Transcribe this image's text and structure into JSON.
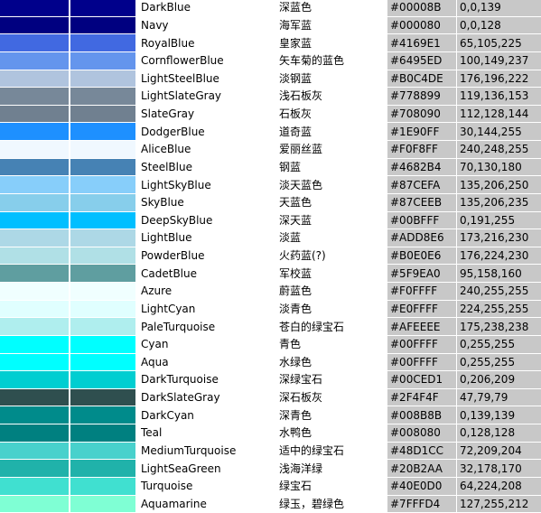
{
  "rows": [
    {
      "name": "DarkBlue",
      "zh": "深蓝色",
      "hex": "#00008B",
      "rgb": "0,0,139",
      "color": "#00008B"
    },
    {
      "name": "Navy",
      "zh": "海军蓝",
      "hex": "#000080",
      "rgb": "0,0,128",
      "color": "#000080"
    },
    {
      "name": "RoyalBlue",
      "zh": "皇家蓝",
      "hex": "#4169E1",
      "rgb": "65,105,225",
      "color": "#4169E1"
    },
    {
      "name": "CornflowerBlue",
      "zh": "矢车菊的蓝色",
      "hex": "#6495ED",
      "rgb": "100,149,237",
      "color": "#6495ED"
    },
    {
      "name": "LightSteelBlue",
      "zh": "淡钢蓝",
      "hex": "#B0C4DE",
      "rgb": "176,196,222",
      "color": "#B0C4DE"
    },
    {
      "name": "LightSlateGray",
      "zh": "浅石板灰",
      "hex": "#778899",
      "rgb": "119,136,153",
      "color": "#778899"
    },
    {
      "name": "SlateGray",
      "zh": "石板灰",
      "hex": "#708090",
      "rgb": "112,128,144",
      "color": "#708090"
    },
    {
      "name": "DodgerBlue",
      "zh": "道奇蓝",
      "hex": "#1E90FF",
      "rgb": "30,144,255",
      "color": "#1E90FF"
    },
    {
      "name": "AliceBlue",
      "zh": "爱丽丝蓝",
      "hex": "#F0F8FF",
      "rgb": "240,248,255",
      "color": "#F0F8FF"
    },
    {
      "name": "SteelBlue",
      "zh": "钢蓝",
      "hex": "#4682B4",
      "rgb": "70,130,180",
      "color": "#4682B4"
    },
    {
      "name": "LightSkyBlue",
      "zh": "淡天蓝色",
      "hex": "#87CEFA",
      "rgb": "135,206,250",
      "color": "#87CEFA"
    },
    {
      "name": "SkyBlue",
      "zh": "天蓝色",
      "hex": "#87CEEB",
      "rgb": "135,206,235",
      "color": "#87CEEB"
    },
    {
      "name": "DeepSkyBlue",
      "zh": "深天蓝",
      "hex": "#00BFFF",
      "rgb": "0,191,255",
      "color": "#00BFFF"
    },
    {
      "name": "LightBlue",
      "zh": "淡蓝",
      "hex": "#ADD8E6",
      "rgb": "173,216,230",
      "color": "#ADD8E6"
    },
    {
      "name": "PowderBlue",
      "zh": "火药蓝(?)",
      "hex": "#B0E0E6",
      "rgb": "176,224,230",
      "color": "#B0E0E6"
    },
    {
      "name": "CadetBlue",
      "zh": "军校蓝",
      "hex": "#5F9EA0",
      "rgb": "95,158,160",
      "color": "#5F9EA0"
    },
    {
      "name": "Azure",
      "zh": "蔚蓝色",
      "hex": "#F0FFFF",
      "rgb": "240,255,255",
      "color": "#F0FFFF"
    },
    {
      "name": "LightCyan",
      "zh": "淡青色",
      "hex": "#E0FFFF",
      "rgb": "224,255,255",
      "color": "#E0FFFF"
    },
    {
      "name": "PaleTurquoise",
      "zh": "苍白的绿宝石",
      "hex": "#AFEEEE",
      "rgb": "175,238,238",
      "color": "#AFEEEE"
    },
    {
      "name": "Cyan",
      "zh": "青色",
      "hex": "#00FFFF",
      "rgb": "0,255,255",
      "color": "#00FFFF"
    },
    {
      "name": "Aqua",
      "zh": "水绿色",
      "hex": "#00FFFF",
      "rgb": "0,255,255",
      "color": "#00FFFF"
    },
    {
      "name": "DarkTurquoise",
      "zh": "深绿宝石",
      "hex": "#00CED1",
      "rgb": "0,206,209",
      "color": "#00CED1"
    },
    {
      "name": "DarkSlateGray",
      "zh": "深石板灰",
      "hex": "#2F4F4F",
      "rgb": "47,79,79",
      "color": "#2F4F4F"
    },
    {
      "name": "DarkCyan",
      "zh": "深青色",
      "hex": "#008B8B",
      "rgb": "0,139,139",
      "color": "#008B8B"
    },
    {
      "name": "Teal",
      "zh": "水鸭色",
      "hex": "#008080",
      "rgb": "0,128,128",
      "color": "#008080"
    },
    {
      "name": "MediumTurquoise",
      "zh": "适中的绿宝石",
      "hex": "#48D1CC",
      "rgb": "72,209,204",
      "color": "#48D1CC"
    },
    {
      "name": "LightSeaGreen",
      "zh": "浅海洋绿",
      "hex": "#20B2AA",
      "rgb": "32,178,170",
      "color": "#20B2AA"
    },
    {
      "name": "Turquoise",
      "zh": "绿宝石",
      "hex": "#40E0D0",
      "rgb": "64,224,208",
      "color": "#40E0D0"
    },
    {
      "name": "Aquamarine",
      "zh": "绿玉，碧绿色",
      "hex": "#7FFFD4",
      "rgb": "127,255,212",
      "color": "#7FFFD4"
    }
  ]
}
